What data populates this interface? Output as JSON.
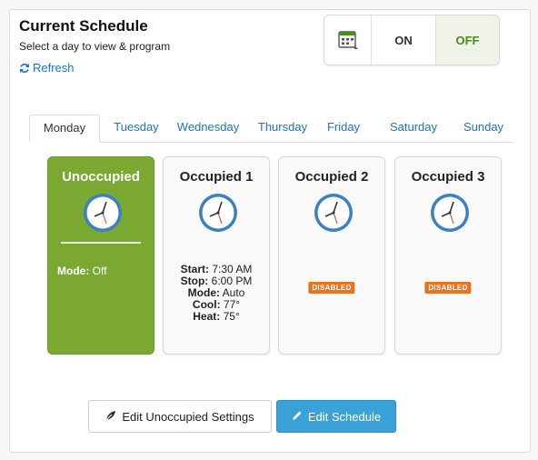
{
  "header": {
    "title": "Current Schedule",
    "subtitle": "Select a day to view & program",
    "refresh_label": "Refresh"
  },
  "toggle": {
    "on_label": "ON",
    "off_label": "OFF",
    "selected": "OFF"
  },
  "tabs": [
    {
      "label": "Monday",
      "active": true
    },
    {
      "label": "Tuesday",
      "active": false
    },
    {
      "label": "Wednesday",
      "active": false
    },
    {
      "label": "Thursday",
      "active": false
    },
    {
      "label": "Friday",
      "active": false
    },
    {
      "label": "Saturday",
      "active": false
    },
    {
      "label": "Sunday",
      "active": false
    }
  ],
  "periods": [
    {
      "title": "Unoccupied",
      "mode_label": "Mode:",
      "mode_value": "Off",
      "accent": "#7aa832"
    },
    {
      "title": "Occupied 1",
      "details": [
        {
          "label": "Start:",
          "value": "7:30 AM"
        },
        {
          "label": "Stop:",
          "value": "6:00 PM"
        },
        {
          "label": "Mode:",
          "value": "Auto"
        },
        {
          "label": "Cool:",
          "value": "77°"
        },
        {
          "label": "Heat:",
          "value": "75°"
        }
      ]
    },
    {
      "title": "Occupied 2",
      "badge": "DISABLED"
    },
    {
      "title": "Occupied 3",
      "badge": "DISABLED"
    }
  ],
  "actions": {
    "edit_unoccupied_label": "Edit Unoccupied Settings",
    "edit_schedule_label": "Edit Schedule"
  },
  "colors": {
    "link": "#1a73c8",
    "primary_button": "#3aa2d6",
    "disabled_badge": "#e8731f",
    "off_text": "#4a8a1e"
  }
}
